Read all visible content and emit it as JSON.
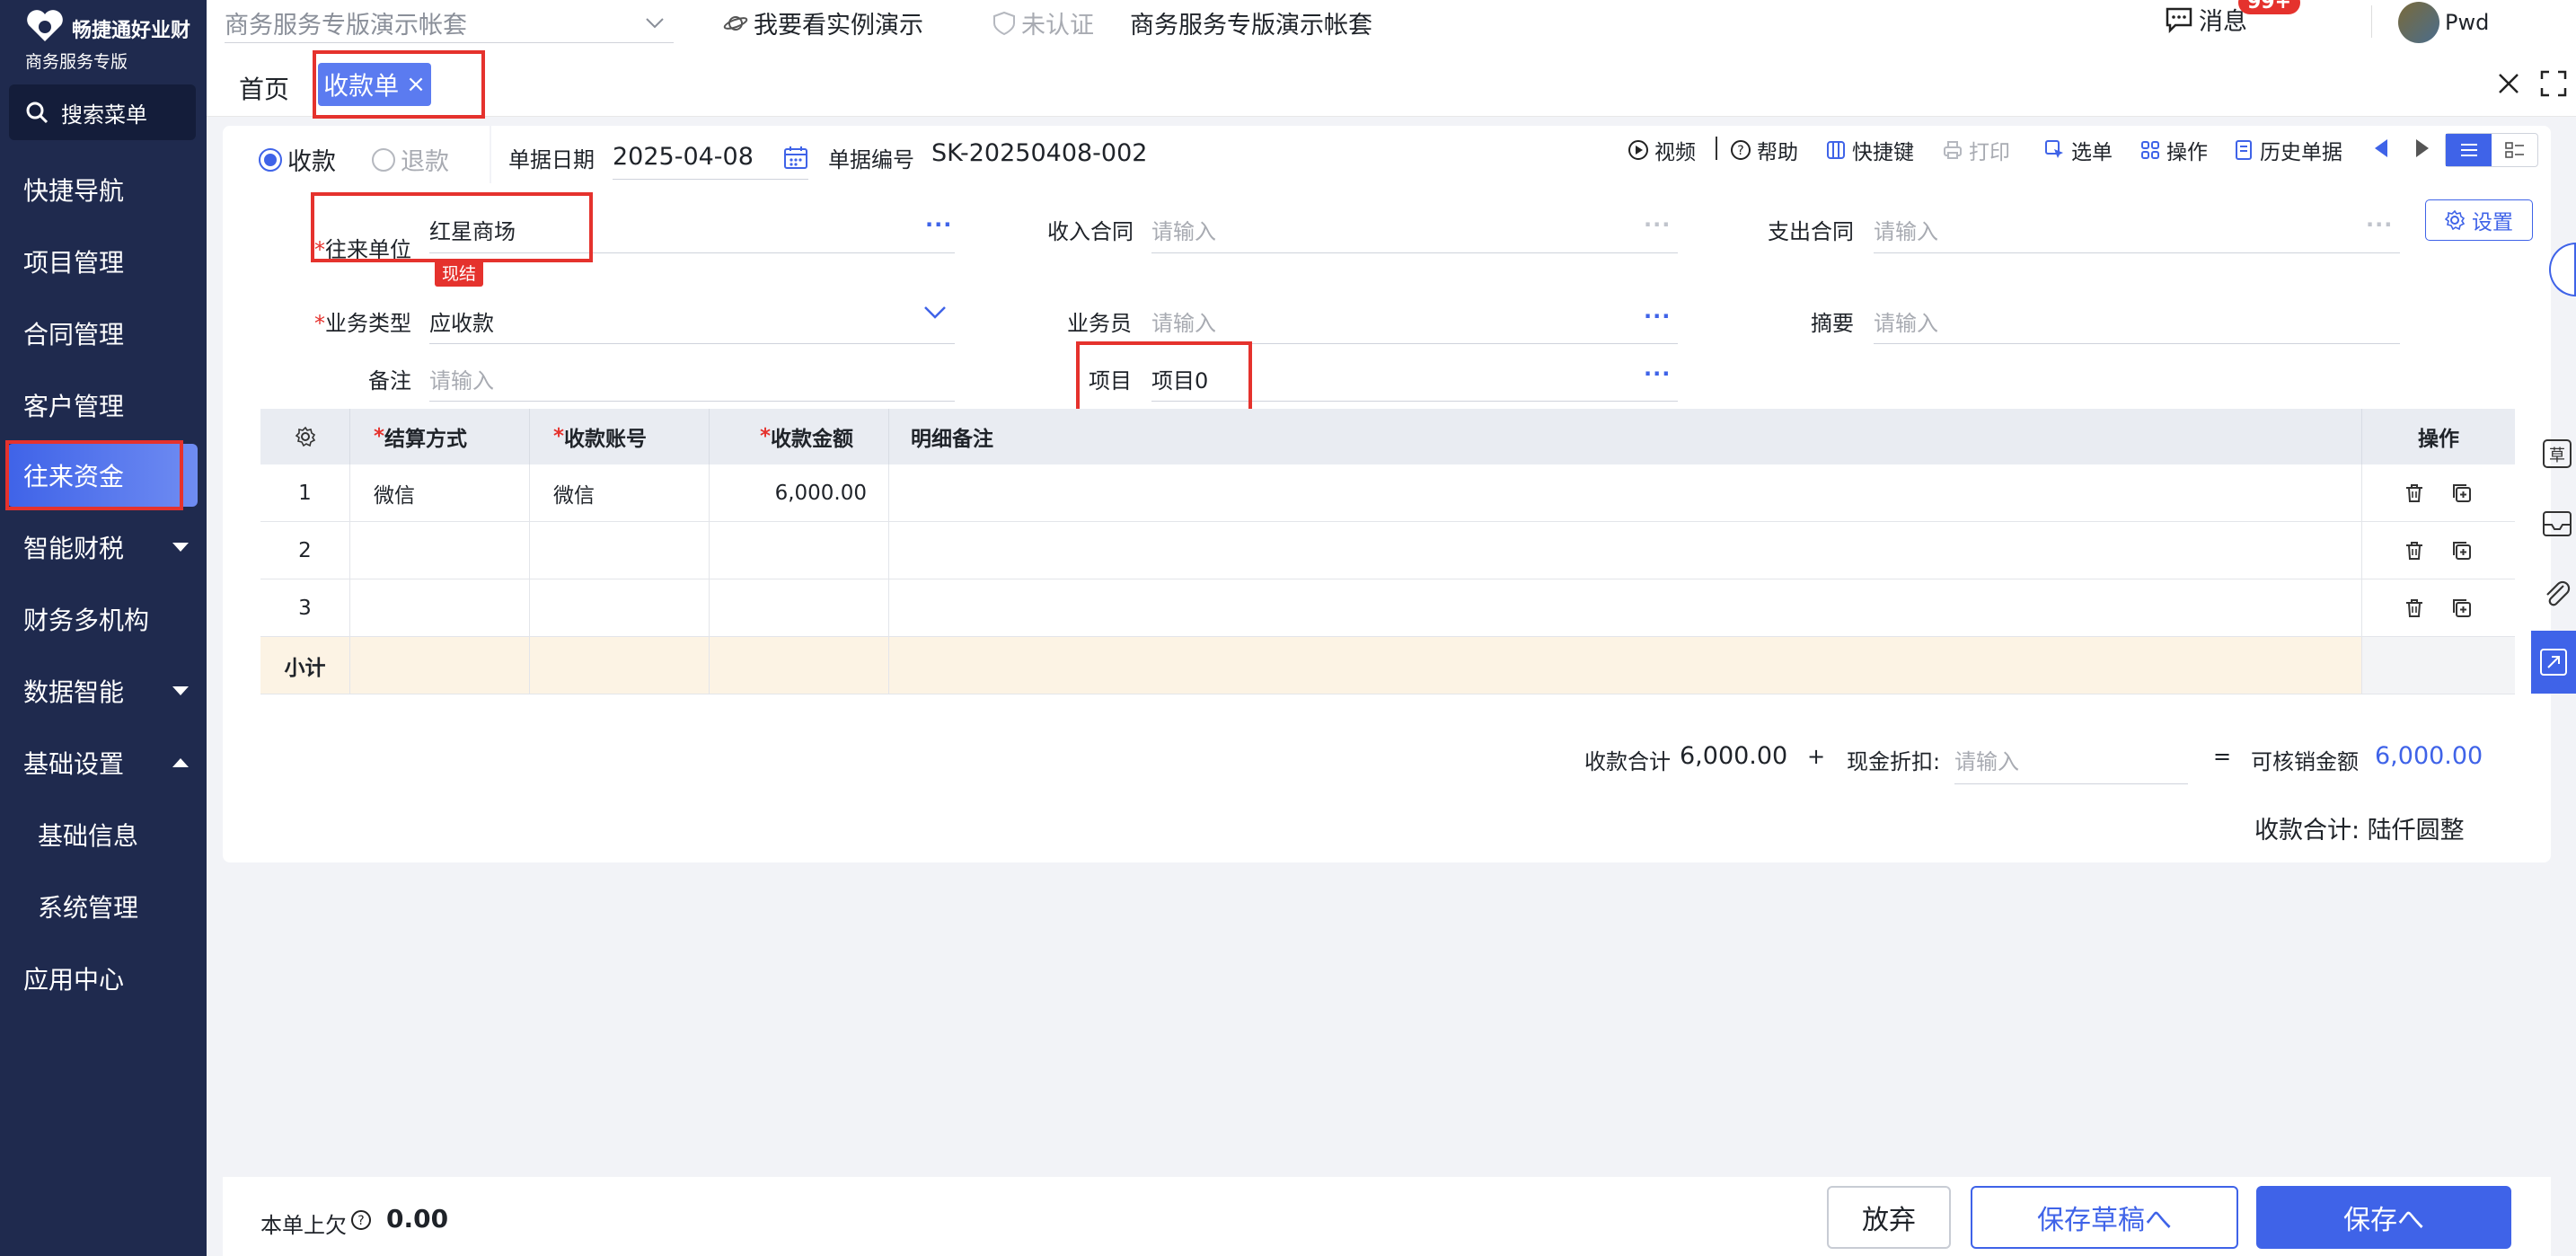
{
  "brand": {
    "name": "畅捷通好业财",
    "sub": "商务服务专版"
  },
  "sidebar": {
    "search_label": "搜索菜单",
    "items": [
      {
        "label": "快捷导航"
      },
      {
        "label": "项目管理"
      },
      {
        "label": "合同管理"
      },
      {
        "label": "客户管理"
      },
      {
        "label": "往来资金",
        "active": true
      },
      {
        "label": "智能财税",
        "caret": "down"
      },
      {
        "label": "财务多机构"
      },
      {
        "label": "数据智能",
        "caret": "down"
      },
      {
        "label": "基础设置",
        "caret": "up"
      },
      {
        "label": "基础信息",
        "sub": true
      },
      {
        "label": "系统管理",
        "sub": true
      },
      {
        "label": "应用中心"
      }
    ]
  },
  "topbar": {
    "account_select": "商务服务专版演示帐套",
    "demo_link": "我要看实例演示",
    "cert_status": "未认证",
    "account_name": "商务服务专版演示帐套",
    "messages_label": "消息",
    "messages_badge": "99+",
    "user_name": "Pwd"
  },
  "tabs": {
    "home": "首页",
    "active": "收款单",
    "close": "×"
  },
  "form": {
    "type_receive": "收款",
    "type_refund": "退款",
    "date_label": "单据日期",
    "date_value": "2025-04-08",
    "number_label": "单据编号",
    "number_value": "SK-20250408-002",
    "toolbar": {
      "video": "视频",
      "help": "帮助",
      "shortcut": "快捷键",
      "print": "打印",
      "select": "选单",
      "operate": "操作",
      "history": "历史单据"
    },
    "settings": "设置",
    "partner_label": "往来单位",
    "partner_value": "红星商场",
    "partner_tag": "现结",
    "income_contract_label": "收入合同",
    "income_contract_placeholder": "请输入",
    "expense_contract_label": "支出合同",
    "expense_contract_placeholder": "请输入",
    "biz_type_label": "业务类型",
    "biz_type_value": "应收款",
    "salesperson_label": "业务员",
    "salesperson_placeholder": "请输入",
    "summary_label": "摘要",
    "summary_placeholder": "请输入",
    "remark_label": "备注",
    "remark_placeholder": "请输入",
    "project_label": "项目",
    "project_value": "项目0"
  },
  "table": {
    "headers": {
      "method": "结算方式",
      "account": "收款账号",
      "amount": "收款金额",
      "note": "明细备注",
      "ops": "操作"
    },
    "rows": [
      {
        "no": "1",
        "method": "微信",
        "account": "微信",
        "amount": "6,000.00",
        "note": ""
      },
      {
        "no": "2",
        "method": "",
        "account": "",
        "amount": "",
        "note": ""
      },
      {
        "no": "3",
        "method": "",
        "account": "",
        "amount": "",
        "note": ""
      }
    ],
    "subtotal_label": "小计"
  },
  "totals": {
    "total_label": "收款合计",
    "total_value": "6,000.00",
    "plus": "+",
    "discount_label": "现金折扣:",
    "discount_placeholder": "请输入",
    "equals": "=",
    "writeoff_label": "可核销金额",
    "writeoff_value": "6,000.00",
    "uppercase": "收款合计: 陆仟圆整"
  },
  "footer": {
    "prev_owed_label": "本单上欠",
    "prev_owed_value": "0.00",
    "discard": "放弃",
    "save_draft": "保存草稿へ",
    "save": "保存へ"
  },
  "colors": {
    "primary": "#3f63e8",
    "sidebar": "#1f2a4e",
    "highlight": "#e5322d"
  }
}
